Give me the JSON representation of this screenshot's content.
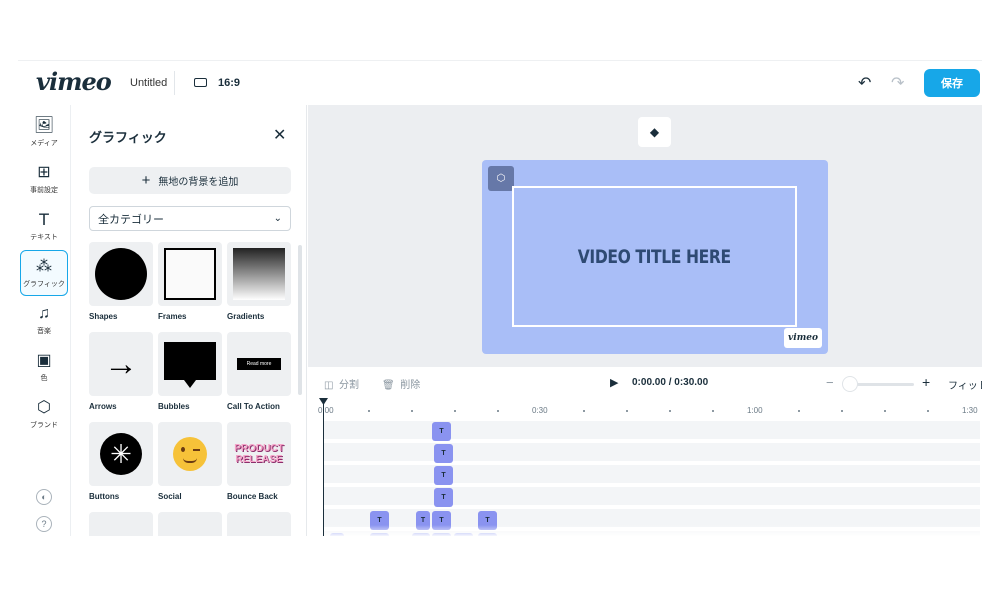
{
  "header": {
    "logo": "vimeo",
    "doc_title": "Untitled",
    "ratio": "16:9",
    "undo_icon": "undo-icon",
    "redo_icon": "redo-icon",
    "save_label": "保存",
    "accent": "#17a7e8"
  },
  "rail": {
    "items": [
      {
        "icon": "image-icon",
        "glyph": "▧",
        "label": "メディア"
      },
      {
        "icon": "grid-icon",
        "glyph": "⊞",
        "label": "事前設定"
      },
      {
        "icon": "text-icon",
        "glyph": "T",
        "label": "テキスト"
      },
      {
        "icon": "graphics-icon",
        "glyph": "⁂",
        "label": "グラフィック"
      },
      {
        "icon": "music-icon",
        "glyph": "♫",
        "label": "音楽"
      },
      {
        "icon": "color-icon",
        "glyph": "▣",
        "label": "色"
      },
      {
        "icon": "brand-icon",
        "glyph": "⬡",
        "label": "ブランド"
      }
    ],
    "active_index": 3
  },
  "panel": {
    "title": "グラフィック",
    "add_background": "無地の背景を追加",
    "category": "全カテゴリー",
    "tiles": [
      {
        "label": "Shapes"
      },
      {
        "label": "Frames"
      },
      {
        "label": "Gradients"
      },
      {
        "label": "Arrows"
      },
      {
        "label": "Bubbles"
      },
      {
        "label": "Call To Action",
        "preview_text": "Read more"
      },
      {
        "label": "Buttons"
      },
      {
        "label": "Social"
      },
      {
        "label": "Bounce Back",
        "preview_text": "PRODUCT RELEASE"
      }
    ]
  },
  "stage": {
    "video_title": "VIDEO TITLE HERE",
    "watermark": "vimeo",
    "video_bg": "#a9bef7"
  },
  "timeline": {
    "split_label": "分割",
    "delete_label": "削除",
    "timecode": "0:00.00 / 0:30.00",
    "zoom_minus": "−",
    "zoom_plus": "+",
    "fit_label": "フィット",
    "ruler": [
      "0:00",
      "0:30",
      "1:00",
      "1:30"
    ],
    "clip_label": "T",
    "clip_color": "#8a93f0"
  }
}
